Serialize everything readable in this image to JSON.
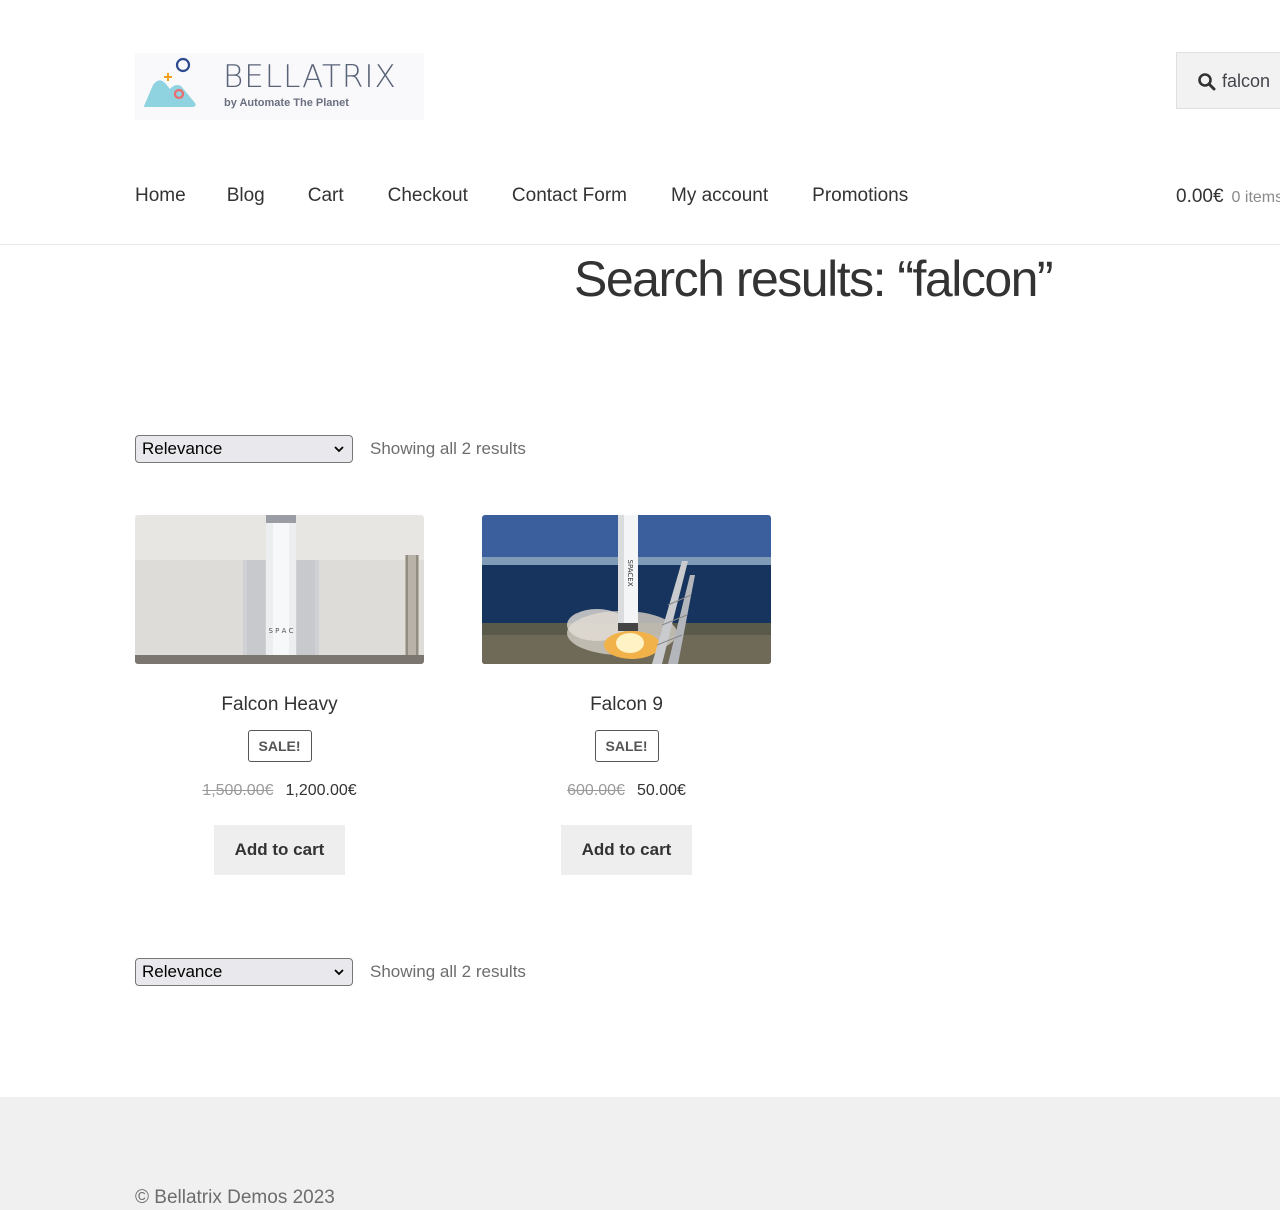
{
  "header": {
    "logo": {
      "title": "BELLATRIX",
      "subtitle": "by Automate The Planet"
    },
    "search": {
      "value": "falcon",
      "icon": "search-icon"
    },
    "nav": [
      {
        "label": "Home"
      },
      {
        "label": "Blog"
      },
      {
        "label": "Cart"
      },
      {
        "label": "Checkout"
      },
      {
        "label": "Contact Form"
      },
      {
        "label": "My account"
      },
      {
        "label": "Promotions"
      }
    ],
    "cart": {
      "total": "0.00€",
      "count": "0 items"
    }
  },
  "main": {
    "title": "Search results: “falcon”",
    "sorting": {
      "selected": "Relevance",
      "result_count": "Showing all 2 results"
    },
    "products": [
      {
        "name": "Falcon Heavy",
        "badge": "Sale!",
        "old_price": "1,500.00€",
        "price": "1,200.00€",
        "button": "Add to cart"
      },
      {
        "name": "Falcon 9",
        "badge": "Sale!",
        "old_price": "600.00€",
        "price": "50.00€",
        "button": "Add to cart"
      }
    ]
  },
  "footer": {
    "copyright": "© Bellatrix Demos 2023"
  },
  "colors": {
    "text": "#333333",
    "muted": "#6d6d6d",
    "footer_bg": "#f0f0f0",
    "button_bg": "#eeeeee"
  }
}
